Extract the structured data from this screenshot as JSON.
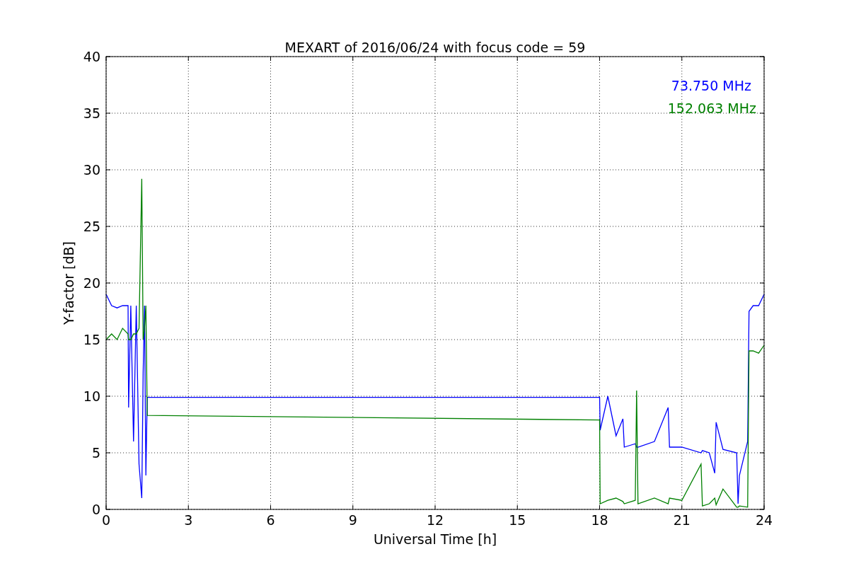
{
  "figure": {
    "chart_data": {
      "type": "line",
      "title": "MEXART of 2016/06/24 with focus code = 59",
      "xlabel": "Universal Time [h]",
      "ylabel": "Y-factor [dB]",
      "x": [
        0,
        0.2,
        0.4,
        0.6,
        0.8,
        0.82,
        0.9,
        1.0,
        1.1,
        1.2,
        1.3,
        1.35,
        1.4,
        1.45,
        1.5,
        18,
        18.02,
        18.3,
        18.6,
        18.85,
        18.9,
        19.3,
        19.35,
        19.4,
        20,
        20.5,
        20.55,
        21,
        21.7,
        21.75,
        22,
        22.2,
        22.25,
        22.5,
        23,
        23.05,
        23.1,
        23.4,
        23.45,
        23.6,
        23.8,
        24
      ],
      "series": [
        {
          "name": "73.750 MHz",
          "color": "#0000ff",
          "values": [
            19,
            18,
            17.8,
            18,
            18,
            9,
            18,
            6,
            18,
            4,
            1,
            12,
            18,
            3,
            9.9,
            9.9,
            7,
            10,
            6.5,
            8,
            5.5,
            5.8,
            5.5,
            5.5,
            6,
            9,
            5.5,
            5.5,
            5,
            5.2,
            5,
            3.2,
            7.7,
            5.3,
            5,
            0.5,
            3,
            6,
            17.5,
            18,
            18,
            19
          ]
        },
        {
          "name": "152.063 MHz",
          "color": "#008000",
          "values": [
            15,
            15.5,
            15,
            16,
            15.5,
            15,
            15,
            15.5,
            15.5,
            16,
            29.2,
            15,
            16,
            18,
            8.3,
            7.9,
            0.5,
            0.8,
            1,
            0.7,
            0.5,
            0.8,
            10.5,
            0.5,
            1,
            0.5,
            1,
            0.8,
            4,
            0.3,
            0.5,
            1,
            0.4,
            1.8,
            0.2,
            0.2,
            0.3,
            0.2,
            14,
            14,
            13.8,
            14.5
          ]
        }
      ],
      "xlim": [
        0,
        24
      ],
      "ylim": [
        0,
        40
      ],
      "xticks": [
        0,
        3,
        6,
        9,
        12,
        15,
        18,
        21,
        24
      ],
      "yticks": [
        0,
        5,
        10,
        15,
        20,
        25,
        30,
        35,
        40
      ],
      "grid": true
    }
  }
}
